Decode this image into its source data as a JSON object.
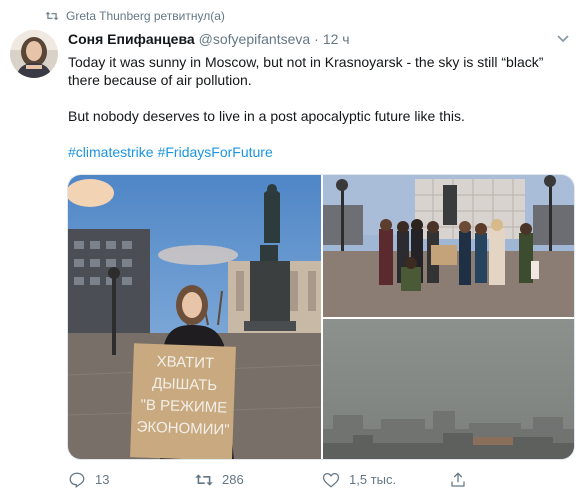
{
  "retweet_note": {
    "text": "Greta Thunberg ретвитнул(а)",
    "icon": "retweet-icon"
  },
  "tweet": {
    "author": {
      "display_name": "Соня Епифанцева",
      "handle": "@sofyepifantseva",
      "separator": "·",
      "time": "12 ч",
      "avatar": "avatar-photo"
    },
    "text_lines": [
      "Today it was sunny in Moscow, but not in Krasnoyarsk - the sky is still “black”",
      "there because of air pollution.",
      "But nobody deserves to live in a post apocalyptic future like this."
    ],
    "hashtags": [
      "#climatestrike",
      "#FridaysForFuture"
    ],
    "media": {
      "left_photo": {
        "sign_lines": [
          "ХВАТИТ",
          "ДЫШАТЬ",
          "\"В РЕЖИМЕ",
          "ЭКОНОМИИ\""
        ]
      },
      "top_right_photo": "group-protest-photo",
      "bottom_right_photo": "smog-city-photo"
    },
    "actions": {
      "reply": {
        "count": "13",
        "icon": "reply-icon"
      },
      "retweet": {
        "count": "286",
        "icon": "retweet-icon"
      },
      "like": {
        "count": "1,5 тыс.",
        "icon": "heart-icon"
      },
      "share": {
        "count": "",
        "icon": "share-icon"
      }
    }
  },
  "colors": {
    "link": "#1b95e0",
    "muted": "#657786",
    "text": "#14171a",
    "smog": "#8b8f8c"
  }
}
